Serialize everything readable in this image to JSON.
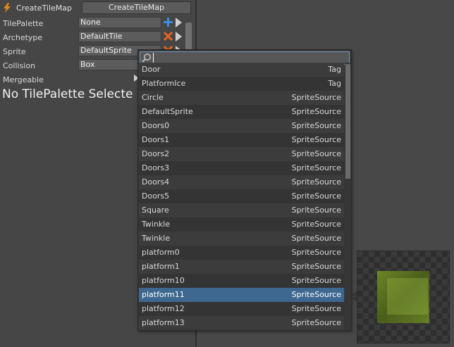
{
  "header": {
    "title": "CreateTileMap",
    "button_label": "CreateTileMap"
  },
  "properties": [
    {
      "label": "TilePalette",
      "value": "None"
    },
    {
      "label": "Archetype",
      "value": "DefaultTile"
    },
    {
      "label": "Sprite",
      "value": "DefaultSprite"
    },
    {
      "label": "Collision",
      "value": "Box"
    },
    {
      "label": "Mergeable",
      "value": ""
    }
  ],
  "message": "No TilePalette Selecte",
  "search": {
    "value": "",
    "placeholder": ""
  },
  "list": {
    "items": [
      {
        "name": "Door",
        "type": "Tag"
      },
      {
        "name": "PlatformIce",
        "type": "Tag"
      },
      {
        "name": "Circle",
        "type": "SpriteSource"
      },
      {
        "name": "DefaultSprite",
        "type": "SpriteSource"
      },
      {
        "name": "Doors0",
        "type": "SpriteSource"
      },
      {
        "name": "Doors1",
        "type": "SpriteSource"
      },
      {
        "name": "Doors2",
        "type": "SpriteSource"
      },
      {
        "name": "Doors3",
        "type": "SpriteSource"
      },
      {
        "name": "Doors4",
        "type": "SpriteSource"
      },
      {
        "name": "Doors5",
        "type": "SpriteSource"
      },
      {
        "name": "Square",
        "type": "SpriteSource"
      },
      {
        "name": "Twinkle",
        "type": "SpriteSource"
      },
      {
        "name": "Twinkle",
        "type": "SpriteSource"
      },
      {
        "name": "platform0",
        "type": "SpriteSource"
      },
      {
        "name": "platform1",
        "type": "SpriteSource"
      },
      {
        "name": "platform10",
        "type": "SpriteSource"
      },
      {
        "name": "platform11",
        "type": "SpriteSource"
      },
      {
        "name": "platform12",
        "type": "SpriteSource"
      },
      {
        "name": "platform13",
        "type": "SpriteSource"
      }
    ],
    "selected_index": 16
  },
  "colors": {
    "selection": "#3e6890",
    "add_icon": "#3d8ee0",
    "remove_icon": "#e0641e",
    "header_icon": "#e08a1e"
  },
  "icons": {
    "header": "lightning-icon",
    "add": "plus-icon",
    "remove": "x-icon",
    "expand": "triangle-right-icon",
    "search": "magnifier-icon"
  }
}
